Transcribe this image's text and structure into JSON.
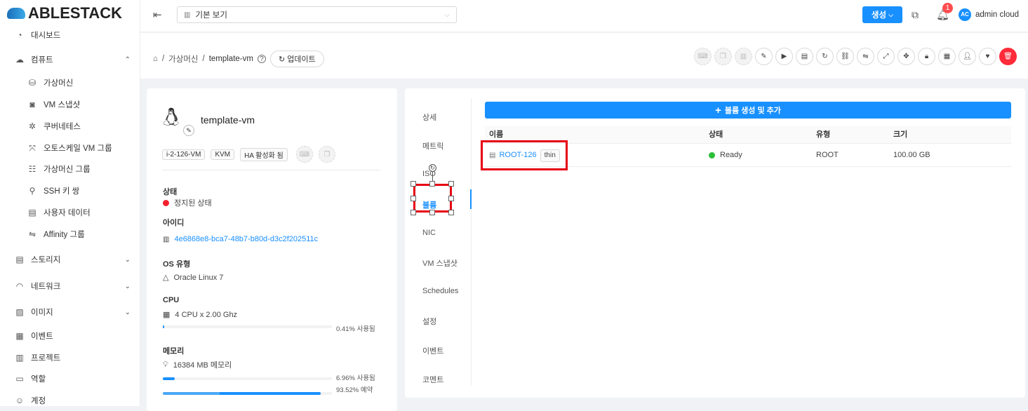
{
  "app": {
    "logo": "ABLESTACK"
  },
  "sidebar": {
    "items": [
      {
        "label": "대시보드",
        "icon": "dashboard-icon"
      },
      {
        "label": "컴퓨트",
        "icon": "cloud-icon",
        "expanded": true
      },
      {
        "label": "가상머신",
        "icon": "vm-icon",
        "sub": true
      },
      {
        "label": "VM 스냅샷",
        "icon": "camera-icon",
        "sub": true
      },
      {
        "label": "쿠버네테스",
        "icon": "kubernetes-icon",
        "sub": true
      },
      {
        "label": "오토스케일 VM 그룹",
        "icon": "autoscale-icon",
        "sub": true
      },
      {
        "label": "가상머신 그룹",
        "icon": "group-icon",
        "sub": true
      },
      {
        "label": "SSH 키 쌍",
        "icon": "key-icon",
        "sub": true
      },
      {
        "label": "사용자 데이터",
        "icon": "userdata-icon",
        "sub": true
      },
      {
        "label": "Affinity 그룹",
        "icon": "swap-icon",
        "sub": true
      },
      {
        "label": "스토리지",
        "icon": "storage-icon",
        "expandable": true
      },
      {
        "label": "네트워크",
        "icon": "wifi-icon",
        "expandable": true
      },
      {
        "label": "이미지",
        "icon": "image-icon",
        "expandable": true
      },
      {
        "label": "이벤트",
        "icon": "calendar-icon"
      },
      {
        "label": "프로젝트",
        "icon": "project-icon"
      },
      {
        "label": "역할",
        "icon": "role-icon"
      },
      {
        "label": "계정",
        "icon": "account-icon"
      }
    ]
  },
  "header": {
    "view": "기본 보기",
    "create": "생성",
    "notifications": "1",
    "avatar": "AC",
    "user": "admin cloud"
  },
  "breadcrumb": {
    "parent": "가상머신",
    "current": "template-vm",
    "refresh": "업데이트"
  },
  "vm": {
    "name": "template-vm",
    "tags": [
      "i-2-126-VM",
      "KVM",
      "HA 활성화 됨"
    ],
    "state_label": "상태",
    "state": "정지된 상태",
    "id_label": "아이디",
    "id": "4e6868e8-bca7-48b7-b80d-d3c2f202511c",
    "os_label": "OS 유형",
    "os": "Oracle Linux 7",
    "cpu_label": "CPU",
    "cpu": "4 CPU x 2.00 Ghz",
    "cpu_used": 0.41,
    "cpu_used_text": "0.41% 사용됨",
    "mem_label": "메모리",
    "mem": "16384 MB 메모리",
    "mem_used": 6.96,
    "mem_used_text": "6.96% 사용됨",
    "mem_reserved": 93.52,
    "mem_reserved_text": "93.52% 예약"
  },
  "tabs": [
    "상세",
    "메트릭",
    "ISO",
    "볼륨",
    "NIC",
    "VM 스냅샷",
    "Schedules",
    "설정",
    "이벤트",
    "코멘트"
  ],
  "active_tab": "볼륨",
  "volumes": {
    "add": "볼륨 생성 및 추가",
    "columns": [
      "이름",
      "상태",
      "유형",
      "크기"
    ],
    "rows": [
      {
        "name": "ROOT-126",
        "tag": "thin",
        "state": "Ready",
        "type": "ROOT",
        "size": "100.00 GB"
      }
    ]
  },
  "colors": {
    "accent": "#1890ff",
    "danger": "#ff2b3a",
    "ready": "#2bbf3a",
    "stopped": "#f5222d"
  }
}
